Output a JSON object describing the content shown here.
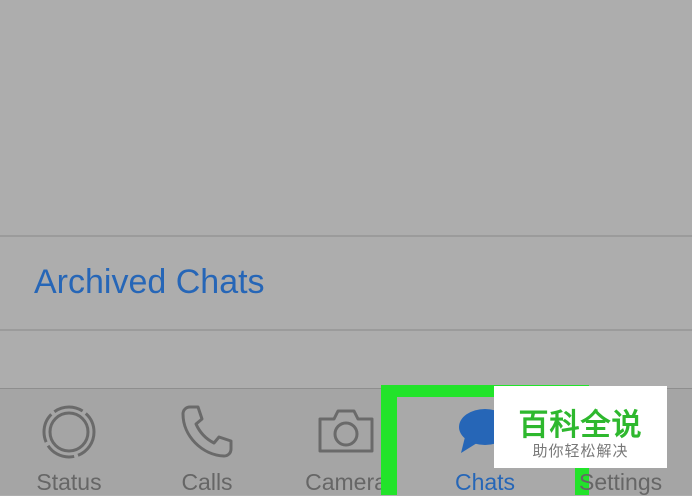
{
  "archived": {
    "label": "Archived Chats"
  },
  "tabs": [
    {
      "label": "Status",
      "icon": "status-ring-icon"
    },
    {
      "label": "Calls",
      "icon": "phone-icon"
    },
    {
      "label": "Camera",
      "icon": "camera-icon"
    },
    {
      "label": "Chats",
      "icon": "chat-bubble-icon"
    },
    {
      "label": "Settings",
      "icon": "gear-icon"
    }
  ],
  "watermark": {
    "title": "百科全说",
    "subtitle": "助你轻松解决"
  },
  "colors": {
    "accent": "#2666b7",
    "highlight": "#22e32a",
    "watermark_green": "#2eb82e"
  }
}
